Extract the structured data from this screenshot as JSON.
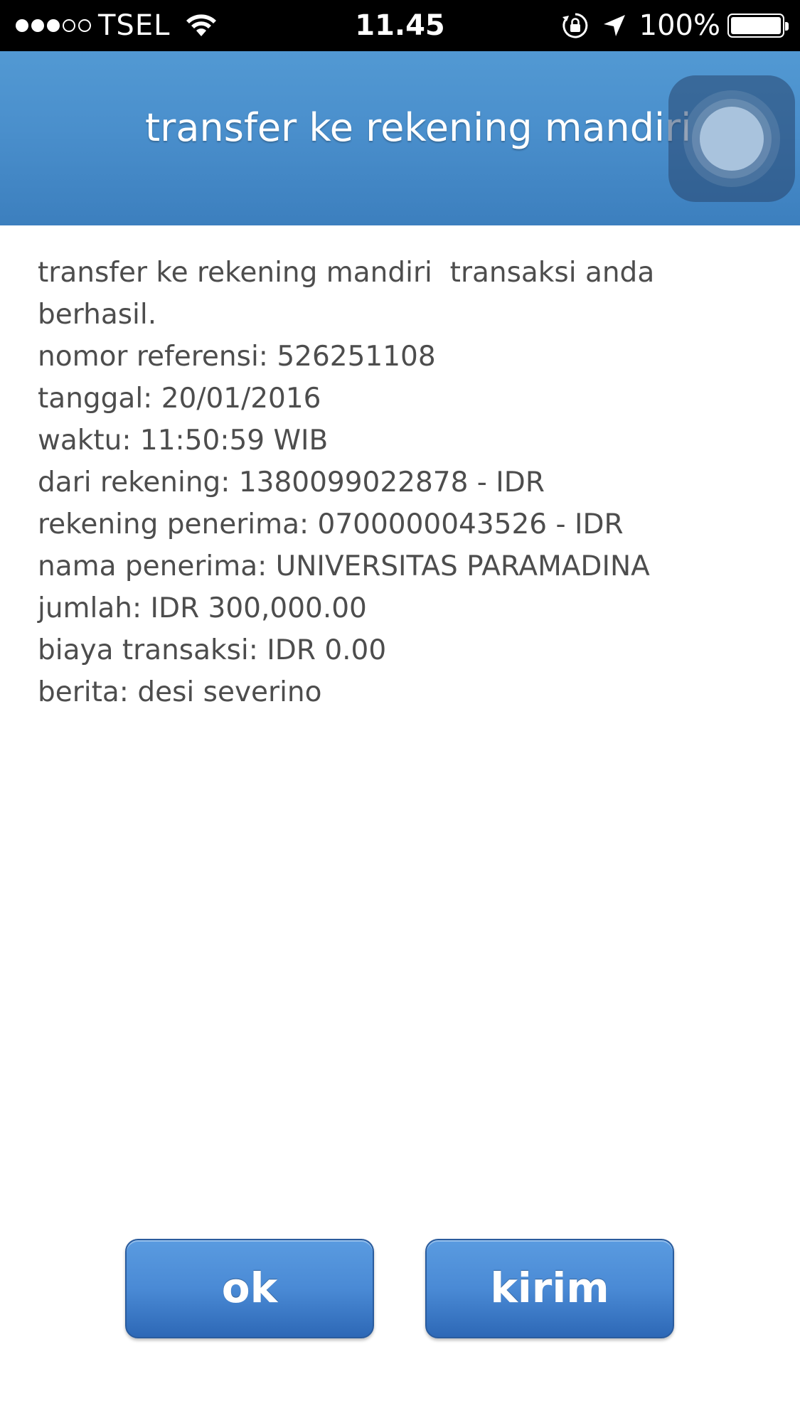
{
  "status_bar": {
    "signal_bars": 3,
    "signal_total": 5,
    "carrier": "TSEL",
    "time": "11.45",
    "battery_percent": "100%",
    "battery_level": 1.0,
    "icons": [
      "wifi-icon",
      "rotation-lock-icon",
      "location-arrow-icon",
      "battery-icon"
    ]
  },
  "header": {
    "title": "transfer ke rekening mandiri"
  },
  "assistive_touch": {
    "icon": "assistive-touch-icon"
  },
  "receipt": {
    "lines": [
      "transfer ke rekening mandiri  transaksi anda",
      "berhasil.",
      "nomor referensi: 526251108",
      "tanggal: 20/01/2016",
      "waktu: 11:50:59 WIB",
      "dari rekening: 1380099022878 - IDR",
      "rekening penerima: 0700000043526 - IDR",
      "nama penerima: UNIVERSITAS PARAMADINA",
      "jumlah: IDR 300,000.00",
      "biaya transaksi: IDR 0.00",
      "berita: desi severino"
    ]
  },
  "buttons": {
    "ok_label": "ok",
    "kirim_label": "kirim"
  },
  "colors": {
    "header_blue": "#4a8fcc",
    "button_blue": "#4a8ad5",
    "text_gray": "#4d4d4d"
  }
}
